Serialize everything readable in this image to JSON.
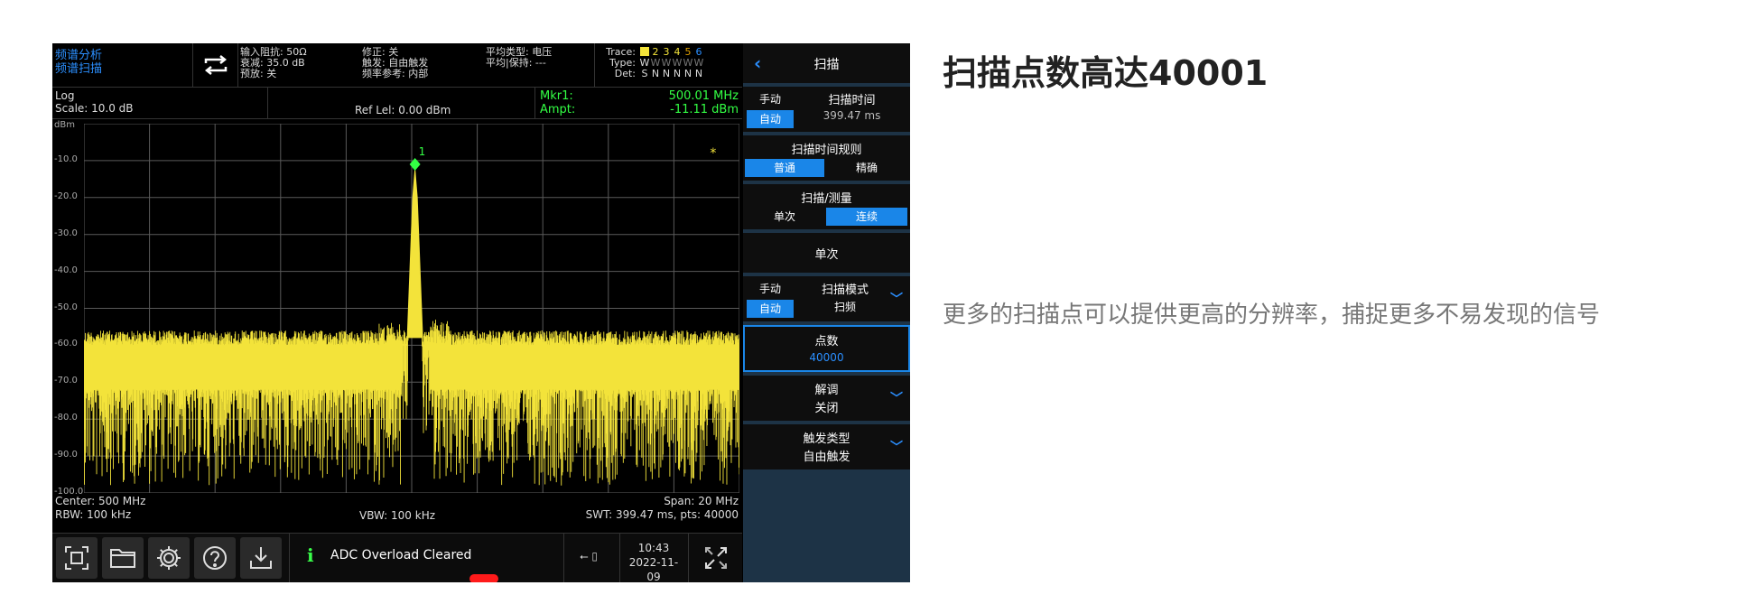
{
  "headline": "扫描点数高达40001",
  "description": "更多的扫描点可以提供更高的分辨率，捕捉更多不易发现的信号",
  "analyzer": {
    "mode_line1": "频谱分析",
    "mode_line2": "频谱扫描",
    "status_col1": [
      "输入阻抗: 50Ω",
      "衰减: 35.0 dB",
      "预放: 关"
    ],
    "status_col2": [
      "修正: 关",
      "触发: 自由触发",
      "频率参考: 内部"
    ],
    "status_col3": [
      "平均类型: 电压",
      "平均|保持: ---"
    ],
    "trace": {
      "trace_label": "Trace:",
      "type_label": "Type:",
      "det_label": "Det:",
      "numbers": [
        "1",
        "2",
        "3",
        "4",
        "5",
        "6"
      ],
      "types": [
        "W",
        "W",
        "W",
        "W",
        "W",
        "W"
      ],
      "dets": [
        "S",
        "N",
        "N",
        "N",
        "N",
        "N"
      ]
    },
    "scale_type": "Log",
    "scale": "Scale: 10.0 dB",
    "ref_level": "Ref Lel: 0.00 dBm",
    "marker_label": "Mkr1:",
    "marker_freq": "500.01 MHz",
    "ampt_label": "Ampt:",
    "marker_ampt": "-11.11 dBm",
    "y_unit": "dBm",
    "y_ticks": [
      "-10.0",
      "-20.0",
      "-30.0",
      "-40.0",
      "-50.0",
      "-60.0",
      "-70.0",
      "-80.0",
      "-90.0",
      "-100.0"
    ],
    "marker_number": "1",
    "marker_star": "*",
    "center": "Center: 500 MHz",
    "rbw": "RBW: 100 kHz",
    "vbw": "VBW: 100 kHz",
    "span": "Span: 20 MHz",
    "swt": "SWT: 399.47 ms, pts: 40000",
    "message": "ADC Overload Cleared",
    "time": "10:43",
    "date": "2022-11-09",
    "colors": {
      "trace": "#f3e33a",
      "marker": "#33ff44",
      "accent": "#1a86e8",
      "grid": "#5a5a5a"
    }
  },
  "panel": {
    "title": "扫描",
    "manual": "手动",
    "auto": "自动",
    "sweep_time_label": "扫描时间",
    "sweep_time_value": "399.47 ms",
    "sweep_rule_label": "扫描时间规则",
    "rule_normal": "普通",
    "rule_accurate": "精确",
    "sweep_measure_label": "扫描/测量",
    "single_opt": "单次",
    "continuous_opt": "连续",
    "single_button": "单次",
    "sweep_mode_label": "扫描模式",
    "sweep_mode_value": "扫频",
    "points_label": "点数",
    "points_value": "40000",
    "demod_label": "解调",
    "demod_value": "关闭",
    "trigger_label": "触发类型",
    "trigger_value": "自由触发"
  }
}
